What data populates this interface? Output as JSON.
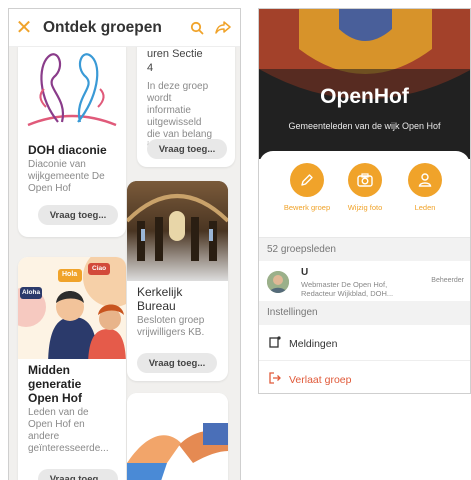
{
  "left": {
    "header": {
      "title": "Ontdek groepen",
      "close_icon": "close-icon",
      "search_icon": "search-icon",
      "share_icon": "share-icon"
    },
    "cards": [
      {
        "title": "DOH diaconie",
        "description": "Diaconie van wijkgemeente De Open Hof",
        "button": "Vraag toeg..."
      },
      {
        "title": "Midden generatie Open Hof",
        "description": "Leden van de Open Hof en andere geïnteresseerde...",
        "button": "Vraag toeg...",
        "bubbles": [
          "Hola",
          "Ciao",
          "Aloha"
        ]
      },
      {
        "title_fragment": "uren Sectie 4",
        "description": "In deze groep wordt informatie uitgewisseld die van belang is vo...",
        "button": "Vraag toeg..."
      },
      {
        "title": "Kerkelijk Bureau",
        "description": "Besloten groep vrijwilligers KB.",
        "button": "Vraag toeg..."
      }
    ]
  },
  "right": {
    "group": {
      "name": "OpenHof",
      "subtitle": "Gemeenteleden van de wijk Open Hof"
    },
    "actions": [
      {
        "label": "Bewerk groep",
        "icon": "pencil-icon"
      },
      {
        "label": "Wijzig foto",
        "icon": "camera-icon"
      },
      {
        "label": "Leden",
        "icon": "person-icon"
      }
    ],
    "members_count": "52 groepsleden",
    "member": {
      "name": "U",
      "role": "Webmaster De Open Hof, Redacteur Wijkblad, DOH...",
      "badge": "Beheerder"
    },
    "settings_header": "Instellingen",
    "settings": [
      {
        "label": "Meldingen",
        "icon": "notification-icon"
      },
      {
        "label": "Verlaat groep",
        "icon": "leave-icon"
      }
    ],
    "accent": "#f0a32a",
    "danger": "#e05a3a"
  }
}
